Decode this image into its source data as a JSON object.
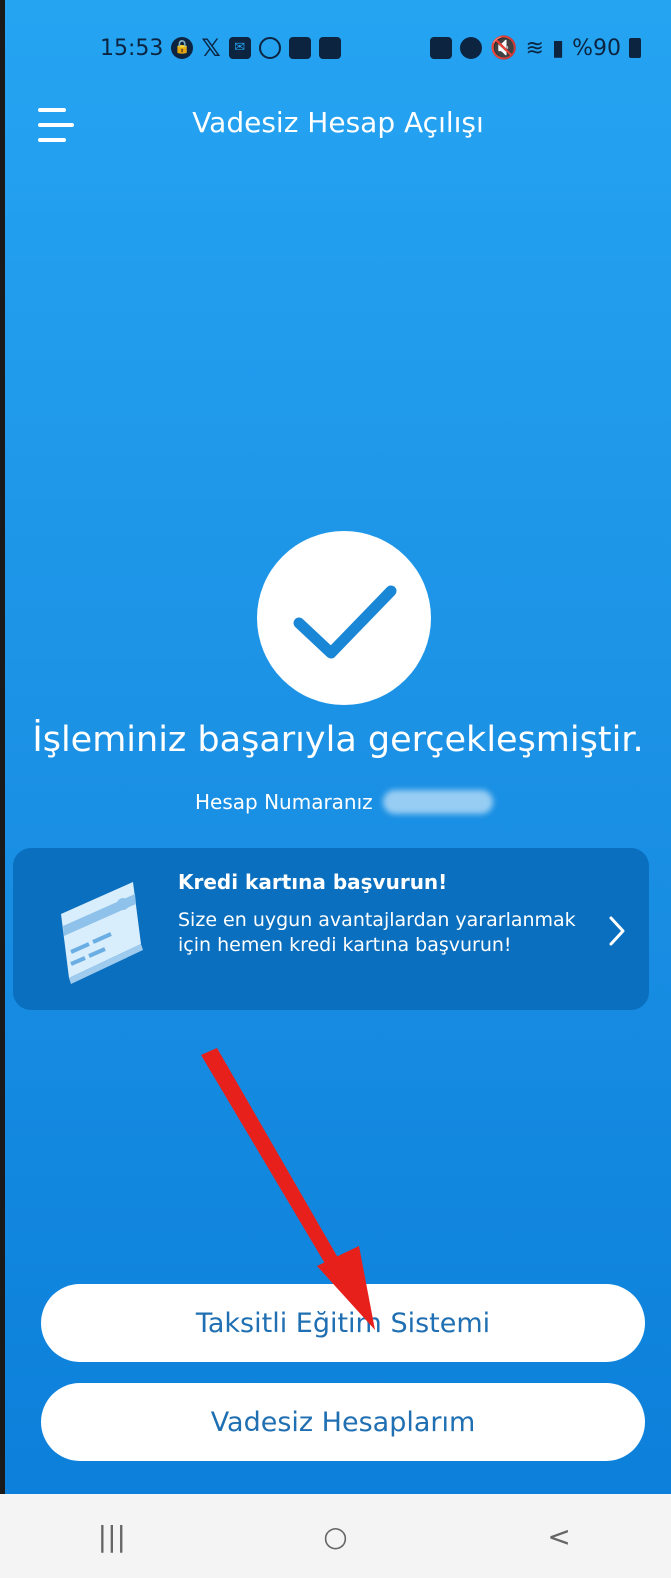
{
  "status_bar": {
    "time": "15:53",
    "battery_text": "%90",
    "left_icons": [
      "lock-icon",
      "x-app-icon",
      "mail-icon",
      "clock-icon",
      "app-icon",
      "gallery-icon"
    ],
    "right_icons": [
      "alarm-lock-icon",
      "alarm-icon",
      "mute-icon",
      "wifi-icon",
      "signal-icon",
      "battery-icon"
    ]
  },
  "header": {
    "menu_icon": "hamburger-menu-icon",
    "title": "Vadesiz Hesap Açılışı"
  },
  "result": {
    "icon": "checkmark-icon",
    "message": "İşleminiz başarıyla gerçekleşmiştir.",
    "account_label": "Hesap Numaranız"
  },
  "promo": {
    "icon": "credit-card-icon",
    "title": "Kredi kartına başvurun!",
    "description": "Size en uygun avantajlardan yararlanmak için hemen kredi kartına başvurun!",
    "chevron_icon": "chevron-right-icon"
  },
  "buttons": {
    "primary": "Taksitli Eğitim Sistemi",
    "secondary": "Vadesiz Hesaplarım"
  },
  "nav": {
    "recents": "|||",
    "home": "○",
    "back": "<"
  },
  "colors": {
    "background_top": "#25a4f2",
    "background_bottom": "#0c80da",
    "promo_bg": "#0a6fbe",
    "button_text": "#1f6fb2",
    "annotation_arrow": "#e8201c"
  }
}
